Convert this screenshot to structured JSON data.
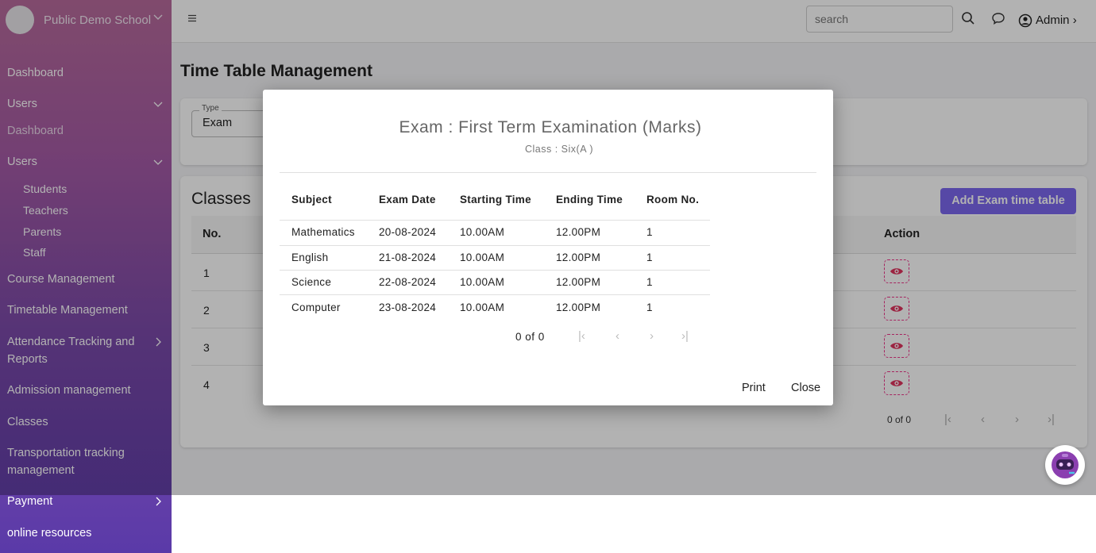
{
  "sidebar": {
    "school_name": "Public Demo School",
    "items": [
      {
        "label": "Dashboard"
      },
      {
        "label": "Users"
      },
      {
        "label": "Dashboard"
      },
      {
        "label": "Users"
      },
      {
        "label": "Course Management"
      },
      {
        "label": "Timetable Management"
      },
      {
        "label": "Attendance Tracking and"
      },
      {
        "label": "Reports"
      },
      {
        "label": "Admission management"
      },
      {
        "label": "Classes"
      },
      {
        "label": "Transportation tracking"
      },
      {
        "label": "management"
      },
      {
        "label": "Payment"
      },
      {
        "label": "online resources"
      }
    ],
    "user_subitems": [
      {
        "label": "Students"
      },
      {
        "label": "Teachers"
      },
      {
        "label": "Parents"
      },
      {
        "label": "Staff"
      }
    ]
  },
  "topbar": {
    "menu_icon": "hamburger-icon",
    "search_placeholder": "search",
    "user_label": "Admin"
  },
  "page": {
    "title": "Time Table Management",
    "filter": {
      "label": "Type",
      "value": "Exam"
    },
    "classes_title": "Classes",
    "add_button": "Add Exam time table",
    "table_headers": {
      "no": "No.",
      "action": "Action"
    },
    "rows": [
      {
        "no": "1"
      },
      {
        "no": "2"
      },
      {
        "no": "3"
      },
      {
        "no": "4"
      }
    ],
    "pager": "0 of 0"
  },
  "modal": {
    "title": "Exam : First Term Examination (Marks)",
    "subtitle": "Class : Six(A )",
    "headers": [
      "Subject",
      "Exam Date",
      "Starting Time",
      "Ending Time",
      "Room No."
    ],
    "rows": [
      [
        "Mathematics",
        "20-08-2024",
        "10.00AM",
        "12.00PM",
        "1"
      ],
      [
        "English",
        "21-08-2024",
        "10.00AM",
        "12.00PM",
        "1"
      ],
      [
        "Science",
        "22-08-2024",
        "10.00AM",
        "12.00PM",
        "1"
      ],
      [
        "Computer",
        "23-08-2024",
        "10.00AM",
        "12.00PM",
        "1"
      ]
    ],
    "pager": "0 of 0",
    "print_label": "Print",
    "close_label": "Close"
  },
  "colors": {
    "accent": "#7b68ee",
    "sidebar_top": "#b86b9c",
    "sidebar_bottom": "#5a3aa8",
    "eye_icon": "#e0335e"
  }
}
